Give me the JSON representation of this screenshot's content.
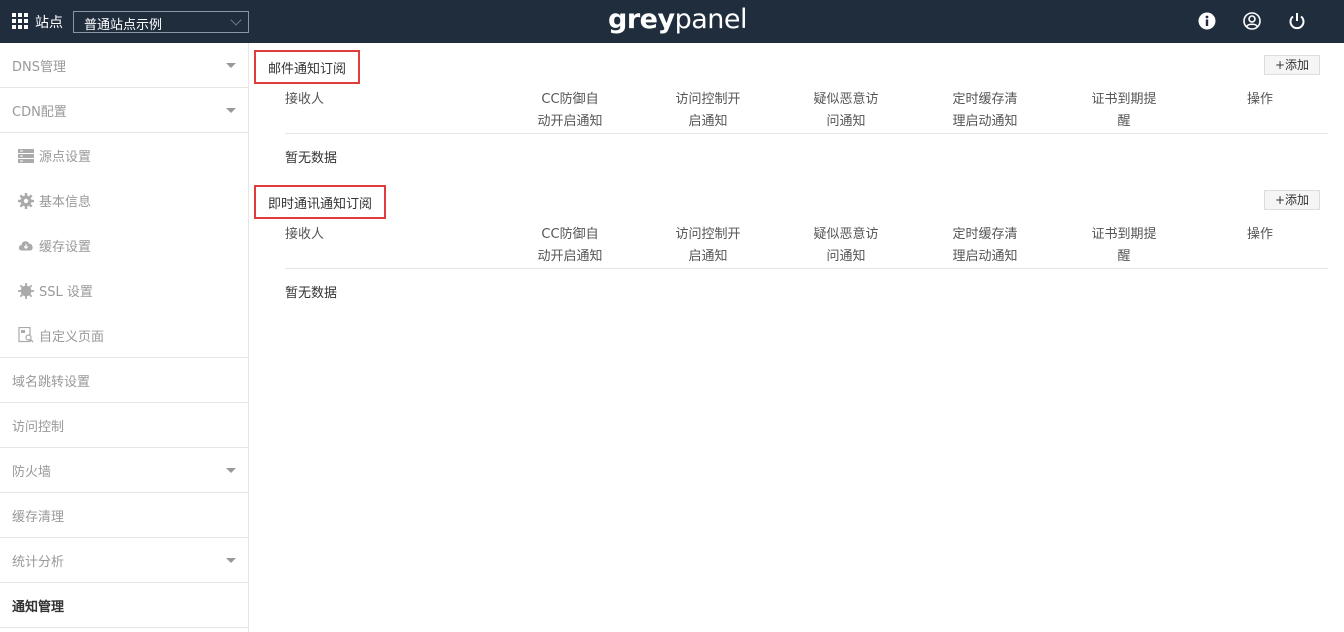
{
  "topbar": {
    "site_label": "站点",
    "site_select_value": "普通站点示例",
    "logo_grey": "grey",
    "logo_panel": "panel"
  },
  "sidebar": {
    "items": [
      {
        "label": "DNS管理",
        "type": "group",
        "expandable": true
      },
      {
        "label": "CDN配置",
        "type": "group",
        "expandable": true
      },
      {
        "label": "源点设置",
        "type": "sub",
        "icon": "server-icon"
      },
      {
        "label": "基本信息",
        "type": "sub",
        "icon": "gear-icon"
      },
      {
        "label": "缓存设置",
        "type": "sub",
        "icon": "cloud-download-icon"
      },
      {
        "label": "SSL 设置",
        "type": "sub",
        "icon": "cog-badge-icon"
      },
      {
        "label": "自定义页面",
        "type": "sub",
        "icon": "page-search-icon"
      },
      {
        "label": "域名跳转设置",
        "type": "group",
        "expandable": false
      },
      {
        "label": "访问控制",
        "type": "group",
        "expandable": false
      },
      {
        "label": "防火墙",
        "type": "group",
        "expandable": true
      },
      {
        "label": "缓存清理",
        "type": "group",
        "expandable": false
      },
      {
        "label": "统计分析",
        "type": "group",
        "expandable": true
      },
      {
        "label": "通知管理",
        "type": "group",
        "expandable": false,
        "active": true
      }
    ]
  },
  "main": {
    "sections": [
      {
        "title": "邮件通知订阅",
        "add_label": "+添加",
        "empty_text": "暂无数据"
      },
      {
        "title": "即时通讯通知订阅",
        "add_label": "+添加",
        "empty_text": "暂无数据"
      }
    ],
    "columns": [
      {
        "line1": "接收人",
        "line2": ""
      },
      {
        "line1": "CC防御自",
        "line2": "动开启通知"
      },
      {
        "line1": "访问控制开",
        "line2": "启通知"
      },
      {
        "line1": "疑似恶意访",
        "line2": "问通知"
      },
      {
        "line1": "定时缓存清",
        "line2": "理启动通知"
      },
      {
        "line1": "证书到期提",
        "line2": "醒"
      },
      {
        "line1": "操作",
        "line2": ""
      }
    ]
  },
  "colors": {
    "topbar_bg": "#1f2d3d",
    "highlight_border": "#e03c3c",
    "muted_text": "#999999"
  }
}
